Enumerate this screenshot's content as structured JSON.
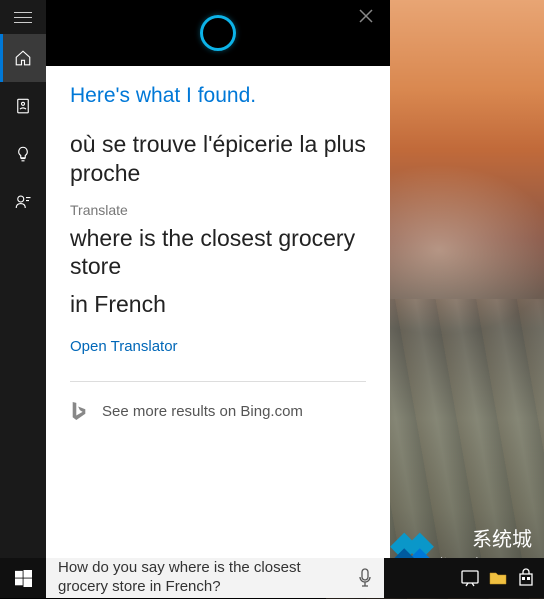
{
  "sidebar": {
    "items": [
      {
        "name": "home",
        "active": true
      },
      {
        "name": "notebook",
        "active": false
      },
      {
        "name": "tips",
        "active": false
      },
      {
        "name": "feedback",
        "active": false
      }
    ]
  },
  "cortana": {
    "header_title": "Here's what I found.",
    "translated_result": "où se trouve l'épicerie la plus proche",
    "translate_label": "Translate",
    "source_phrase": "where is the closest grocery store",
    "language_line": "in French",
    "open_translator_label": "Open Translator",
    "bing_more_label": "See more results on Bing.com"
  },
  "searchbox": {
    "query": "How do you say where is the closest grocery store in French?"
  },
  "watermark": {
    "title": "系统城",
    "subtitle": "www.xitongcheng.com"
  }
}
